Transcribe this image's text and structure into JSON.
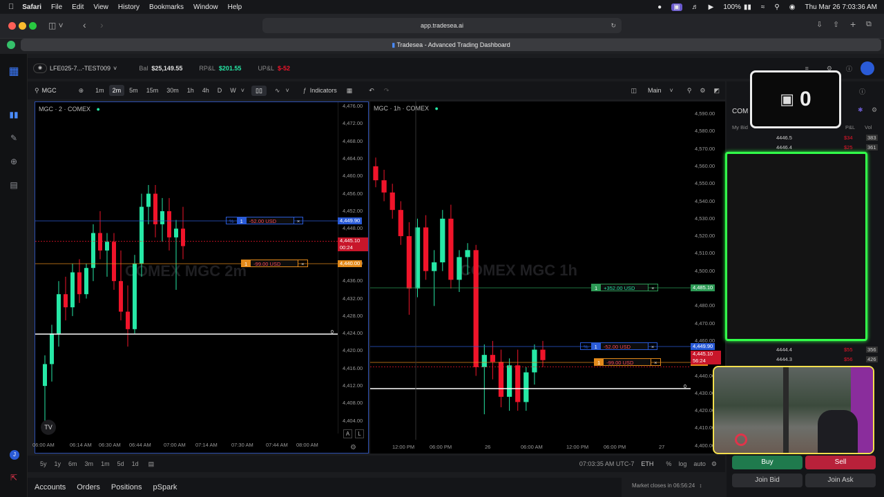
{
  "menubar": {
    "app_name": "Safari",
    "items": [
      "File",
      "Edit",
      "View",
      "History",
      "Bookmarks",
      "Window",
      "Help"
    ],
    "battery": "100%",
    "datetime": "Thu Mar 26  7:03:36 AM"
  },
  "browser": {
    "url": "app.tradesea.ai",
    "tab_title": "Tradesea - Advanced Trading Dashboard"
  },
  "account": {
    "name": "LFE025-7...-TEST009",
    "bal_label": "Bal",
    "bal_value": "$25,149.55",
    "rpl_label": "RP&L",
    "rpl_value": "$201.55",
    "upl_label": "UP&L",
    "upl_value": "$-52"
  },
  "toolbar": {
    "symbol": "MGC",
    "timeframes": [
      "1m",
      "2m",
      "5m",
      "15m",
      "30m",
      "1h",
      "4h",
      "D",
      "W"
    ],
    "active_timeframe": "2m",
    "indicators_label": "Indicators",
    "layout_label": "Main"
  },
  "left_chart": {
    "title": "MGC · 2 · COMEX",
    "watermark": "COMEX MGC 2m",
    "y_ticks": [
      "4,476.00",
      "4,472.00",
      "4,468.00",
      "4,464.00",
      "4,460.00",
      "4,456.00",
      "4,452.00",
      "4,448.00",
      "4,444.00",
      "4,440.00",
      "4,436.00",
      "4,432.00",
      "4,428.00",
      "4,424.00",
      "4,420.00",
      "4,416.00",
      "4,412.00",
      "4,408.00",
      "4,404.00"
    ],
    "x_ticks": [
      "06:00 AM",
      "06:14 AM",
      "06:30 AM",
      "06:44 AM",
      "07:00 AM",
      "07:14 AM",
      "07:30 AM",
      "07:44 AM",
      "08:00 AM"
    ],
    "order_line_1": {
      "qty": "1",
      "pnl": "-52.00 USD",
      "pct": "%",
      "price": "4,449.90"
    },
    "order_line_2": {
      "qty": "1",
      "pnl": "-99.00 USD",
      "price": "4,440.00"
    },
    "last_price": "4,445.10",
    "countdown": "00:24",
    "zero_marker": "0",
    "axis_a": "A",
    "axis_l": "L",
    "candles": [
      {
        "o": 4412,
        "h": 4419,
        "l": 4402,
        "c": 4417
      },
      {
        "o": 4417,
        "h": 4426,
        "l": 4413,
        "c": 4424
      },
      {
        "o": 4424,
        "h": 4436,
        "l": 4421,
        "c": 4433
      },
      {
        "o": 4433,
        "h": 4437,
        "l": 4427,
        "c": 4430
      },
      {
        "o": 4430,
        "h": 4440,
        "l": 4428,
        "c": 4438
      },
      {
        "o": 4438,
        "h": 4441,
        "l": 4431,
        "c": 4433
      },
      {
        "o": 4433,
        "h": 4440,
        "l": 4432,
        "c": 4439
      },
      {
        "o": 4439,
        "h": 4449,
        "l": 4436,
        "c": 4447
      },
      {
        "o": 4447,
        "h": 4452,
        "l": 4441,
        "c": 4443
      },
      {
        "o": 4443,
        "h": 4447,
        "l": 4437,
        "c": 4445
      },
      {
        "o": 4445,
        "h": 4447,
        "l": 4434,
        "c": 4436
      },
      {
        "o": 4436,
        "h": 4443,
        "l": 4427,
        "c": 4429
      },
      {
        "o": 4429,
        "h": 4435,
        "l": 4421,
        "c": 4425
      },
      {
        "o": 4425,
        "h": 4442,
        "l": 4424,
        "c": 4440
      },
      {
        "o": 4440,
        "h": 4456,
        "l": 4437,
        "c": 4453
      },
      {
        "o": 4453,
        "h": 4458,
        "l": 4449,
        "c": 4456
      },
      {
        "o": 4456,
        "h": 4458,
        "l": 4446,
        "c": 4449
      },
      {
        "o": 4449,
        "h": 4455,
        "l": 4445,
        "c": 4452
      },
      {
        "o": 4452,
        "h": 4455,
        "l": 4443,
        "c": 4446
      },
      {
        "o": 4446,
        "h": 4450,
        "l": 4434,
        "c": 4448
      },
      {
        "o": 4448,
        "h": 4453,
        "l": 4441,
        "c": 4444
      }
    ]
  },
  "right_chart": {
    "title": "MGC · 1h · COMEX",
    "watermark": "COMEX MGC 1h",
    "y_ticks": [
      "4,590.00",
      "4,580.00",
      "4,570.00",
      "4,560.00",
      "4,550.00",
      "4,540.00",
      "4,530.00",
      "4,520.00",
      "4,510.00",
      "4,500.00",
      "4,490.00",
      "4,480.00",
      "4,470.00",
      "4,460.00",
      "4,450.00",
      "4,440.00",
      "4,430.00",
      "4,420.00",
      "4,410.00",
      "4,400.00"
    ],
    "x_ticks": [
      "12:00 PM",
      "06:00 PM",
      "26",
      "06:00 AM",
      "12:00 PM",
      "06:00 PM",
      "27"
    ],
    "profit_line": {
      "qty": "1",
      "pnl": "+352.00 USD",
      "price": "4,485.10"
    },
    "order_line_1": {
      "qty": "1",
      "pnl": "-52.00 USD",
      "pct": "%",
      "price": "4,449.90"
    },
    "order_line_2": {
      "qty": "1",
      "pnl": "-99.00 USD",
      "price": "4,440"
    },
    "last_price": "4,445.10",
    "countdown": "56:24",
    "zero_marker": "0",
    "candles": [
      {
        "o": 4560,
        "h": 4565,
        "l": 4548,
        "c": 4552
      },
      {
        "o": 4552,
        "h": 4558,
        "l": 4540,
        "c": 4545
      },
      {
        "o": 4545,
        "h": 4550,
        "l": 4530,
        "c": 4535
      },
      {
        "o": 4535,
        "h": 4540,
        "l": 4515,
        "c": 4520
      },
      {
        "o": 4520,
        "h": 4528,
        "l": 4475,
        "c": 4490
      },
      {
        "o": 4490,
        "h": 4530,
        "l": 4485,
        "c": 4525
      },
      {
        "o": 4525,
        "h": 4532,
        "l": 4495,
        "c": 4500
      },
      {
        "o": 4500,
        "h": 4512,
        "l": 4480,
        "c": 4505
      },
      {
        "o": 4505,
        "h": 4535,
        "l": 4500,
        "c": 4530
      },
      {
        "o": 4530,
        "h": 4538,
        "l": 4490,
        "c": 4495
      },
      {
        "o": 4495,
        "h": 4512,
        "l": 4488,
        "c": 4508
      },
      {
        "o": 4508,
        "h": 4516,
        "l": 4498,
        "c": 4512
      },
      {
        "o": 4512,
        "h": 4515,
        "l": 4440,
        "c": 4445
      },
      {
        "o": 4445,
        "h": 4458,
        "l": 4418,
        "c": 4452
      },
      {
        "o": 4452,
        "h": 4460,
        "l": 4438,
        "c": 4448
      },
      {
        "o": 4448,
        "h": 4455,
        "l": 4422,
        "c": 4428
      },
      {
        "o": 4428,
        "h": 4450,
        "l": 4420,
        "c": 4446
      },
      {
        "o": 4446,
        "h": 4455,
        "l": 4420,
        "c": 4425
      },
      {
        "o": 4425,
        "h": 4445,
        "l": 4420,
        "c": 4442
      },
      {
        "o": 4442,
        "h": 4458,
        "l": 4435,
        "c": 4455
      },
      {
        "o": 4455,
        "h": 4460,
        "l": 4445,
        "c": 4449
      }
    ]
  },
  "dom": {
    "symbol": "COM",
    "col_my_bid": "My Bid",
    "col_pl": "P&L",
    "col_vol": "Vol",
    "rows_top": [
      {
        "price": "4446.5",
        "pl": "$34",
        "vol": "383"
      },
      {
        "price": "4446.4",
        "pl": "$25",
        "vol": "361"
      }
    ],
    "rows_bottom": [
      {
        "price": "4444.4",
        "pl": "$55",
        "vol": "356"
      },
      {
        "price": "4444.3",
        "pl": "$56",
        "vol": "426"
      }
    ],
    "overlay_counter": "0",
    "buy_label": "Buy",
    "sell_label": "Sell",
    "join_bid_label": "Join Bid",
    "join_ask_label": "Join Ask",
    "market_status": "Market closes in 06:56:24"
  },
  "bottom": {
    "ranges": [
      "5y",
      "1y",
      "6m",
      "3m",
      "1m",
      "5d",
      "1d"
    ],
    "clock": "07:03:35 AM UTC-7",
    "session": "ETH",
    "pct": "%",
    "log": "log",
    "auto": "auto",
    "tabs": [
      "Accounts",
      "Orders",
      "Positions",
      "pSpark"
    ]
  },
  "colors": {
    "up": "#26e8a6",
    "down": "#f0142a",
    "accent": "#2a5bd7",
    "buy": "#1f7a4d",
    "sell": "#b8213a"
  }
}
